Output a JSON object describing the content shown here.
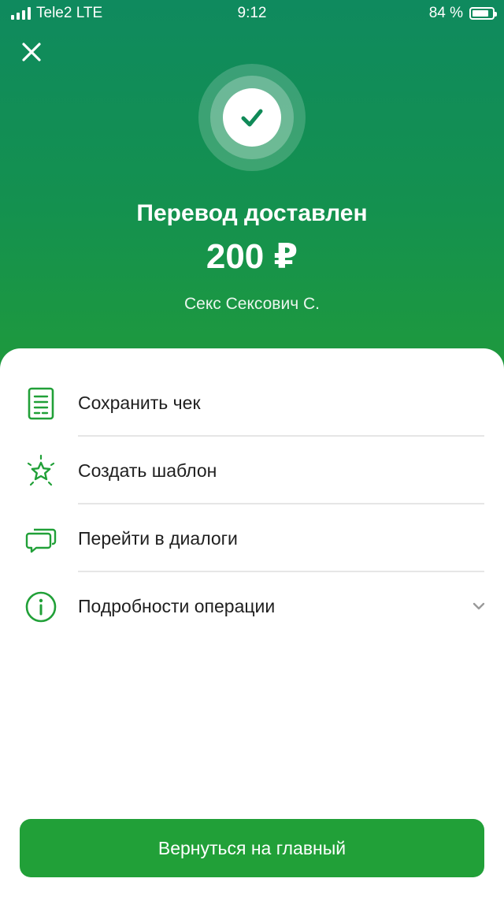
{
  "status_bar": {
    "carrier": "Tele2 LTE",
    "time": "9:12",
    "battery_percent": "84 %",
    "battery_level": 0.84
  },
  "header": {
    "close_icon": "close-icon",
    "success_icon": "check-icon",
    "title": "Перевод доставлен",
    "amount": "200 ₽",
    "recipient": "Секс Сексович С."
  },
  "actions": [
    {
      "label": "Сохранить чек",
      "icon": "receipt-icon"
    },
    {
      "label": "Создать шаблон",
      "icon": "star-icon"
    },
    {
      "label": "Перейти в диалоги",
      "icon": "chat-icon"
    },
    {
      "label": "Подробности операции",
      "icon": "info-icon",
      "expandable": true
    }
  ],
  "footer": {
    "home_button": "Вернуться на главный"
  },
  "colors": {
    "accent": "#21a038",
    "header_top": "#0f8a5e",
    "header_bottom": "#1f9a3c",
    "icon_green": "#21a038"
  }
}
